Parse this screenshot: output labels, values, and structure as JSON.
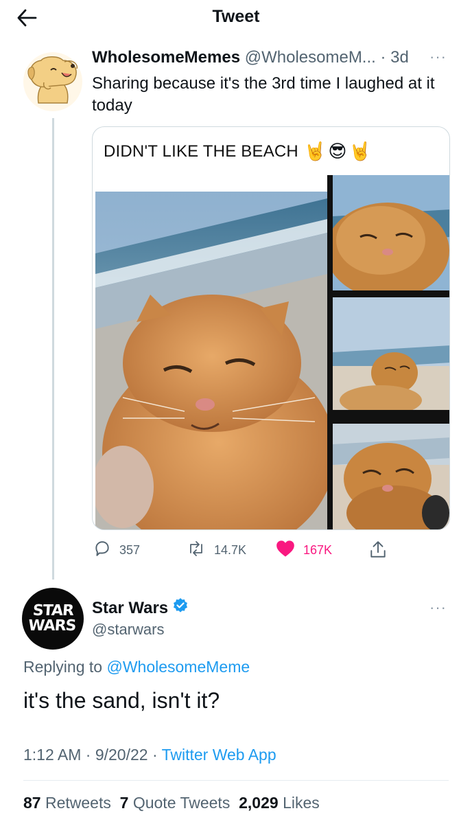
{
  "header": {
    "title": "Tweet"
  },
  "parent_tweet": {
    "name": "WholesomeMemes",
    "handle": "@WholesomeM...",
    "separator": "·",
    "age": "3d",
    "more": "···",
    "text": "Sharing because it's the 3rd time I laughed at it today",
    "meme_caption": "DIDN'T LIKE THE BEACH",
    "meme_emoji": [
      "🤘",
      "😎",
      "🤘"
    ],
    "actions": {
      "replies": "357",
      "retweets": "14.7K",
      "likes": "167K"
    }
  },
  "reply_tweet": {
    "name": "Star Wars",
    "verified": true,
    "handle": "@starwars",
    "more": "···",
    "replying_prefix": "Replying to",
    "replying_mention": "@WholesomeMeme",
    "text": "it's the sand, isn't it?",
    "time": "1:12 AM · 9/20/22 · ",
    "app": "Twitter Web App",
    "avatar_text_top": "STAR",
    "avatar_text_bottom": "WARS"
  },
  "stats": {
    "retweets_count": "87",
    "retweets_label": "Retweets",
    "quotes_count": "7",
    "quotes_label": "Quote Tweets",
    "likes_count": "2,029",
    "likes_label": "Likes"
  },
  "colors": {
    "accent": "#1d9bf0",
    "like": "#f91880",
    "muted": "#536471"
  }
}
